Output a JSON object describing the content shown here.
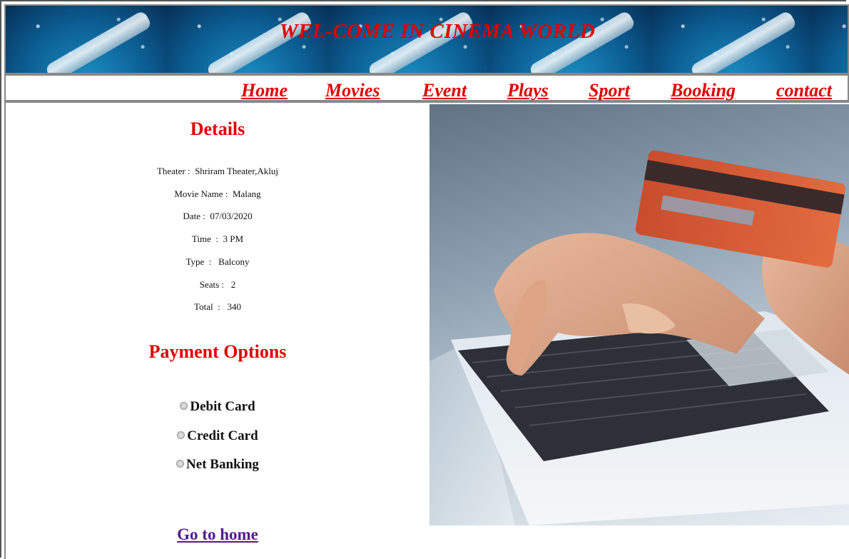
{
  "banner": {
    "title": "WEL-COME IN CINEMA WORLD"
  },
  "nav": {
    "items": [
      {
        "label": "Home"
      },
      {
        "label": "Movies"
      },
      {
        "label": "Event"
      },
      {
        "label": "Plays"
      },
      {
        "label": "Sport"
      },
      {
        "label": "Booking"
      },
      {
        "label": "contact"
      }
    ]
  },
  "details": {
    "heading": "Details",
    "rows": [
      {
        "label": "Theater",
        "value": "Shriram Theater,Akluj"
      },
      {
        "label": "Movie Name",
        "value": "Malang"
      },
      {
        "label": "Date",
        "value": "07/03/2020"
      },
      {
        "label": "Time",
        "value": "3 PM"
      },
      {
        "label": "Type",
        "value": "Balcony"
      },
      {
        "label": "Seats",
        "value": "2"
      },
      {
        "label": "Total",
        "value": "340"
      }
    ]
  },
  "payment": {
    "heading": "Payment Options",
    "options": [
      {
        "label": "Debit Card"
      },
      {
        "label": "Credit Card"
      },
      {
        "label": "Net Banking"
      }
    ]
  },
  "footer": {
    "home_link": "Go to home"
  },
  "colors": {
    "accent_red": "#e00000",
    "visited_link": "#551a8b"
  }
}
